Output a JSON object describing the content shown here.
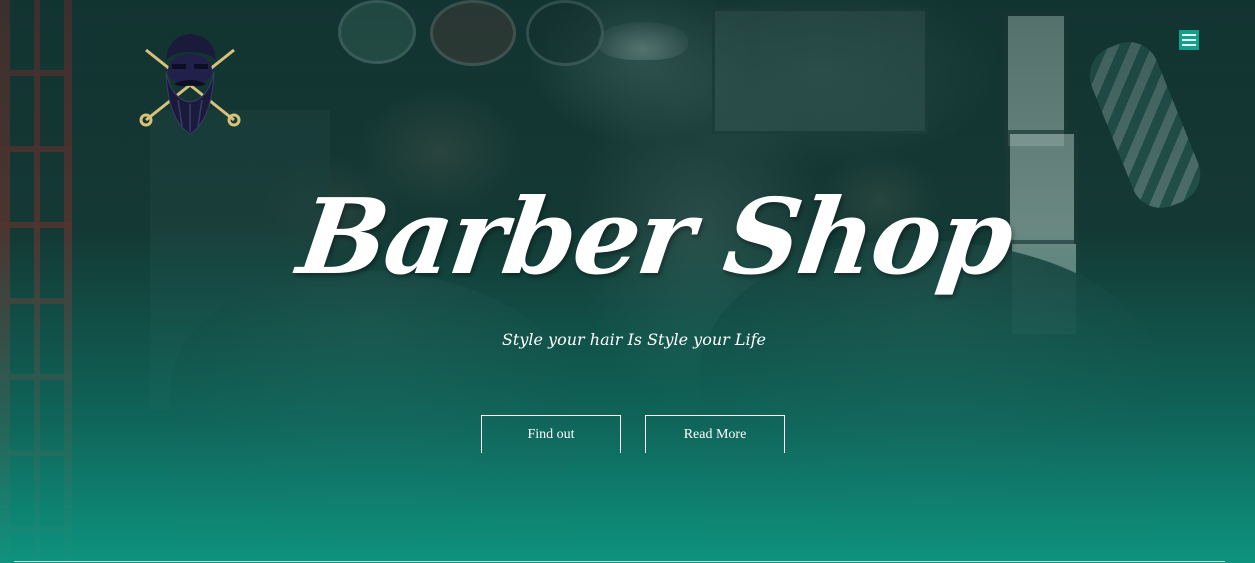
{
  "hero": {
    "title": "Barber Shop",
    "tagline": "Style your hair Is Style your Life",
    "buttons": {
      "find_out": "Find out",
      "read_more": "Read More"
    }
  },
  "logo": {
    "icon": "bearded-man-scissors-logo"
  },
  "nav": {
    "menu_icon": "hamburger-menu-icon"
  },
  "colors": {
    "accent": "#12a08c",
    "overlay_bottom": "#0e9682",
    "text": "#ffffff"
  }
}
